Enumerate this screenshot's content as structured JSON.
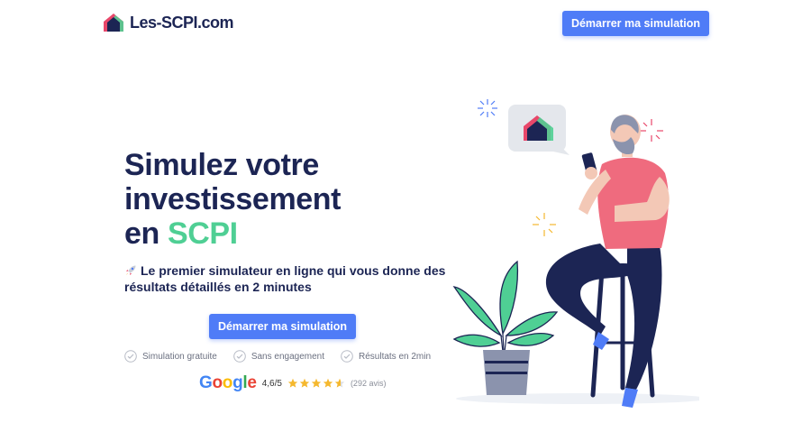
{
  "header": {
    "logo_text": "Les-SCPI.com",
    "cta_label": "Démarrer ma simulation"
  },
  "hero": {
    "title_line1": "Simulez votre",
    "title_line2": "investissement",
    "title_line3_prefix": "en ",
    "title_line3_accent": "SCPI",
    "subtitle": "Le premier simulateur en ligne qui vous donne des résultats détaillés en 2 minutes",
    "cta_label": "Démarrer ma simulation"
  },
  "features": [
    {
      "label": "Simulation gratuite",
      "icon": "check-circle-icon"
    },
    {
      "label": "Sans engagement",
      "icon": "check-circle-icon"
    },
    {
      "label": "Résultats en 2min",
      "icon": "check-circle-icon"
    }
  ],
  "rating": {
    "brand": "Google",
    "score": "4,6/5",
    "stars": 4.6,
    "count": "(292 avis)"
  },
  "colors": {
    "primary": "#4f7cf7",
    "navy": "#1c2554",
    "accent_green": "#4fcf94",
    "star": "#f5b82e"
  }
}
